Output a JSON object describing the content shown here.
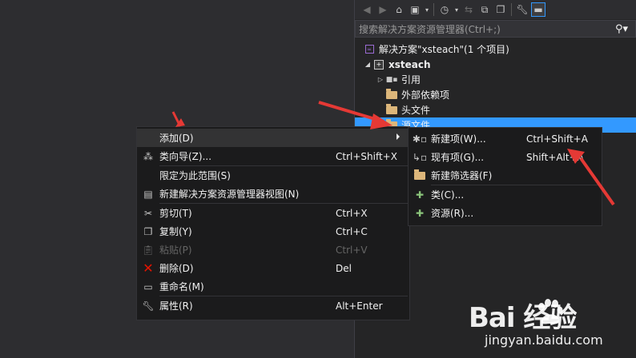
{
  "solution_explorer": {
    "search_placeholder": "搜索解决方案资源管理器(Ctrl+;)",
    "tree": {
      "solution": "解决方案\"xsteach\"(1 个项目)",
      "project": "xsteach",
      "references": "引用",
      "external_deps": "外部依赖项",
      "header_files": "头文件",
      "source_files": "源文件"
    }
  },
  "context_menu": {
    "items": [
      {
        "label": "添加(D)",
        "shortcut": "",
        "submenu": true
      },
      {
        "label": "类向导(Z)...",
        "shortcut": "Ctrl+Shift+X"
      },
      {
        "label": "限定为此范围(S)",
        "shortcut": ""
      },
      {
        "label": "新建解决方案资源管理器视图(N)",
        "shortcut": ""
      },
      {
        "label": "剪切(T)",
        "shortcut": "Ctrl+X"
      },
      {
        "label": "复制(Y)",
        "shortcut": "Ctrl+C"
      },
      {
        "label": "粘贴(P)",
        "shortcut": "Ctrl+V",
        "disabled": true
      },
      {
        "label": "删除(D)",
        "shortcut": "Del"
      },
      {
        "label": "重命名(M)",
        "shortcut": ""
      },
      {
        "label": "属性(R)",
        "shortcut": "Alt+Enter"
      }
    ]
  },
  "add_submenu": {
    "items": [
      {
        "label": "新建项(W)...",
        "shortcut": "Ctrl+Shift+A"
      },
      {
        "label": "现有项(G)...",
        "shortcut": "Shift+Alt+A"
      },
      {
        "label": "新建筛选器(F)",
        "shortcut": ""
      },
      {
        "label": "类(C)...",
        "shortcut": ""
      },
      {
        "label": "资源(R)...",
        "shortcut": ""
      }
    ]
  },
  "watermark": {
    "brand": "Bai  经验",
    "url": "jingyan.baidu.com"
  },
  "colors": {
    "accent": "#3399ff",
    "annotation_arrow": "#e53935",
    "delete_icon": "#e51400",
    "folder": "#dcb67a"
  }
}
